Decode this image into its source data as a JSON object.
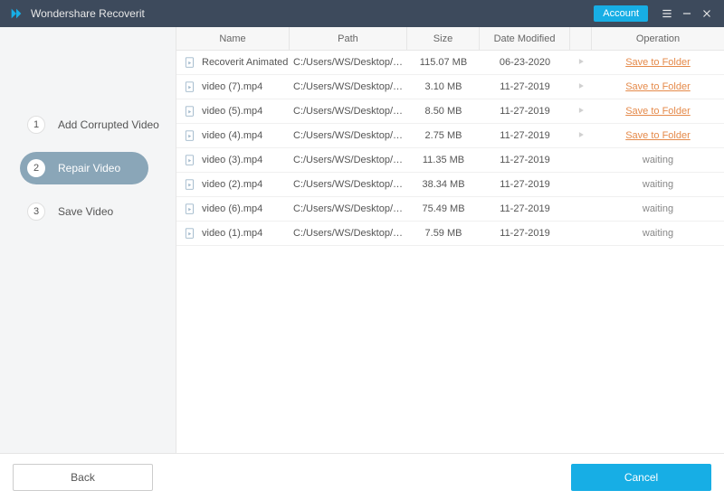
{
  "titlebar": {
    "title": "Wondershare Recoverit",
    "account": "Account"
  },
  "sidebar": {
    "steps": [
      {
        "num": "1",
        "label": "Add Corrupted Video"
      },
      {
        "num": "2",
        "label": "Repair Video"
      },
      {
        "num": "3",
        "label": "Save Video"
      }
    ],
    "active": 1
  },
  "table": {
    "headers": {
      "name": "Name",
      "path": "Path",
      "size": "Size",
      "date": "Date Modified",
      "operation": "Operation"
    },
    "rows": [
      {
        "name": "Recoverit Animated ...",
        "path": "C:/Users/WS/Desktop/Reco...",
        "size": "115.07 MB",
        "date": "06-23-2020",
        "op": "save"
      },
      {
        "name": "video (7).mp4",
        "path": "C:/Users/WS/Desktop/video...",
        "size": "3.10 MB",
        "date": "11-27-2019",
        "op": "save"
      },
      {
        "name": "video (5).mp4",
        "path": "C:/Users/WS/Desktop/video...",
        "size": "8.50 MB",
        "date": "11-27-2019",
        "op": "save"
      },
      {
        "name": "video (4).mp4",
        "path": "C:/Users/WS/Desktop/video...",
        "size": "2.75 MB",
        "date": "11-27-2019",
        "op": "save"
      },
      {
        "name": "video (3).mp4",
        "path": "C:/Users/WS/Desktop/video...",
        "size": "11.35 MB",
        "date": "11-27-2019",
        "op": "wait"
      },
      {
        "name": "video (2).mp4",
        "path": "C:/Users/WS/Desktop/video...",
        "size": "38.34 MB",
        "date": "11-27-2019",
        "op": "wait"
      },
      {
        "name": "video (6).mp4",
        "path": "C:/Users/WS/Desktop/video...",
        "size": "75.49 MB",
        "date": "11-27-2019",
        "op": "wait"
      },
      {
        "name": "video (1).mp4",
        "path": "C:/Users/WS/Desktop/video...",
        "size": "7.59 MB",
        "date": "11-27-2019",
        "op": "wait"
      }
    ],
    "labels": {
      "save": "Save to Folder",
      "waiting": "waiting"
    }
  },
  "footer": {
    "back": "Back",
    "cancel": "Cancel"
  }
}
